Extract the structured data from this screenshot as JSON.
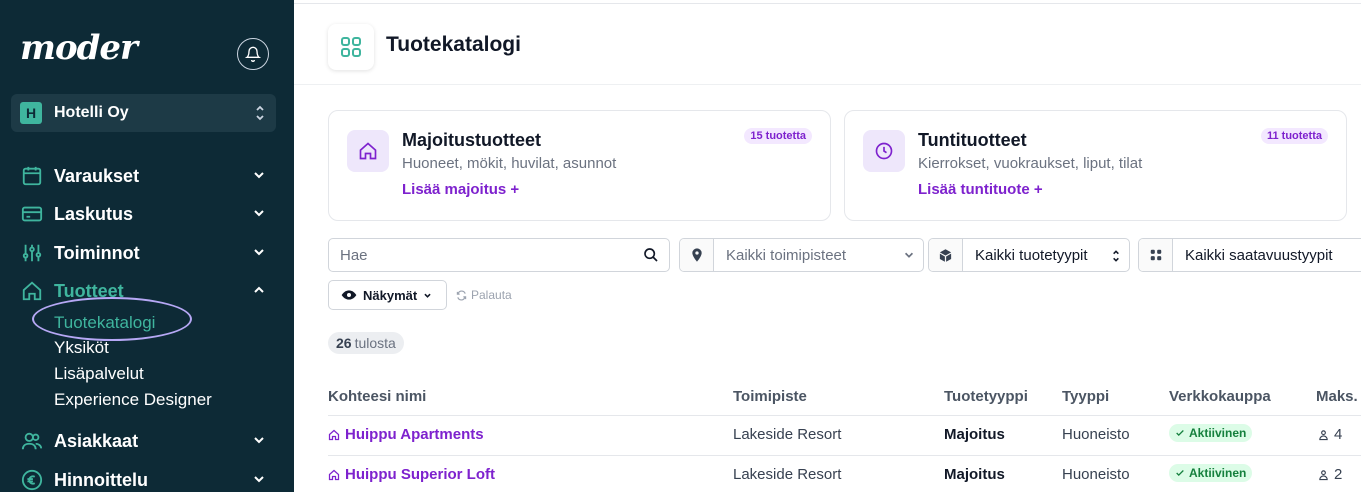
{
  "sidebar": {
    "logo": "moder",
    "org": {
      "initial": "H",
      "name": "Hotelli Oy"
    },
    "nav": [
      {
        "label": "Varaukset",
        "icon": "calendar-icon"
      },
      {
        "label": "Laskutus",
        "icon": "credit-card-icon"
      },
      {
        "label": "Toiminnot",
        "icon": "sliders-icon"
      },
      {
        "label": "Tuotteet",
        "icon": "home-icon",
        "active": true,
        "expanded": true
      },
      {
        "label": "Asiakkaat",
        "icon": "users-icon"
      },
      {
        "label": "Hinnoittelu",
        "icon": "euro-icon"
      }
    ],
    "sub": [
      {
        "label": "Tuotekatalogi",
        "active": true
      },
      {
        "label": "Yksiköt"
      },
      {
        "label": "Lisäpalvelut"
      },
      {
        "label": "Experience Designer"
      }
    ]
  },
  "header": {
    "title": "Tuotekatalogi",
    "icon": "grid-icon"
  },
  "cards": [
    {
      "title": "Majoitustuotteet",
      "subtitle": "Huoneet, mökit, huvilat, asunnot",
      "link": "Lisää majoitus +",
      "badge": "15 tuotetta",
      "icon": "home-icon"
    },
    {
      "title": "Tuntituotteet",
      "subtitle": "Kierrokset, vuokraukset, liput, tilat",
      "link": "Lisää tuntituote +",
      "badge": "11 tuotetta",
      "icon": "clock-icon"
    }
  ],
  "search": {
    "placeholder": "Hae"
  },
  "filters": {
    "location": "Kaikki toimipisteet",
    "product_type": "Kaikki tuotetyypit",
    "availability": "Kaikki saatavuustyypit"
  },
  "views": {
    "label": "Näkymät",
    "reset": "Palauta"
  },
  "results": {
    "count": "26",
    "label": "tulosta"
  },
  "table": {
    "headers": [
      "Kohteesi nimi",
      "Toimipiste",
      "Tuotetyyppi",
      "Tyyppi",
      "Verkkokauppa",
      "Maks."
    ],
    "rows": [
      {
        "name": "Huippu Apartments",
        "location": "Lakeside Resort",
        "product_type": "Majoitus",
        "type": "Huoneisto",
        "status": "Aktiivinen",
        "max": "4"
      },
      {
        "name": "Huippu Superior Loft",
        "location": "Lakeside Resort",
        "product_type": "Majoitus",
        "type": "Huoneisto",
        "status": "Aktiivinen",
        "max": "2"
      }
    ]
  },
  "colors": {
    "sidebar_bg": "#0d2a36",
    "accent": "#3fb59e",
    "link": "#7e22ce",
    "status_bg": "#dcfce7"
  }
}
